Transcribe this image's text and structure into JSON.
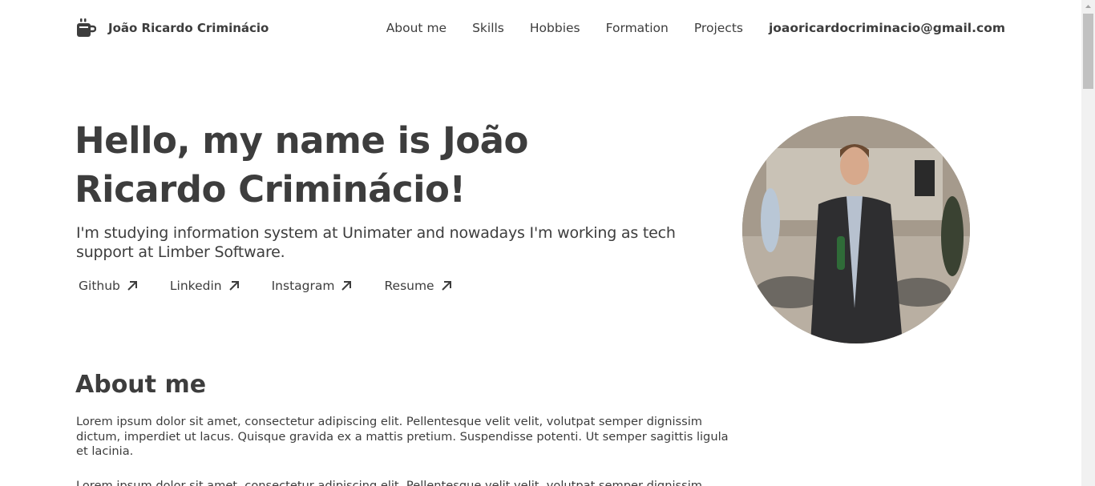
{
  "header": {
    "brand": "João Ricardo Criminácio",
    "logo_icon": "coffee-cup-icon",
    "nav": [
      {
        "label": "About me"
      },
      {
        "label": "Skills"
      },
      {
        "label": "Hobbies"
      },
      {
        "label": "Formation"
      },
      {
        "label": "Projects"
      }
    ],
    "email": "joaoricardocriminacio@gmail.com"
  },
  "hero": {
    "title": "Hello, my name is João Ricardo Criminácio!",
    "subtitle": "I'm studying information system at Unimater and nowadays I'm working as tech support at Limber Software.",
    "links": [
      {
        "label": "Github",
        "icon": "arrow-up-right-icon"
      },
      {
        "label": "Linkedin",
        "icon": "arrow-up-right-icon"
      },
      {
        "label": "Instagram",
        "icon": "arrow-up-right-icon"
      },
      {
        "label": "Resume",
        "icon": "arrow-up-right-icon"
      }
    ],
    "photo": "profile-photo"
  },
  "about": {
    "title": "About me",
    "paragraph1": "Lorem ipsum dolor sit amet, consectetur adipiscing elit. Pellentesque velit velit, volutpat semper dignissim dictum, imperdiet ut lacus. Quisque gravida ex a mattis pretium. Suspendisse potenti. Ut semper sagittis ligula et lacinia.",
    "paragraph2": "Lorem ipsum dolor sit amet, consectetur adipiscing elit. Pellentesque velit velit, volutpat semper dignissim dictum, imperdiet ut lacus."
  },
  "colors": {
    "text": "#3d3d3d",
    "background": "#ffffff"
  }
}
